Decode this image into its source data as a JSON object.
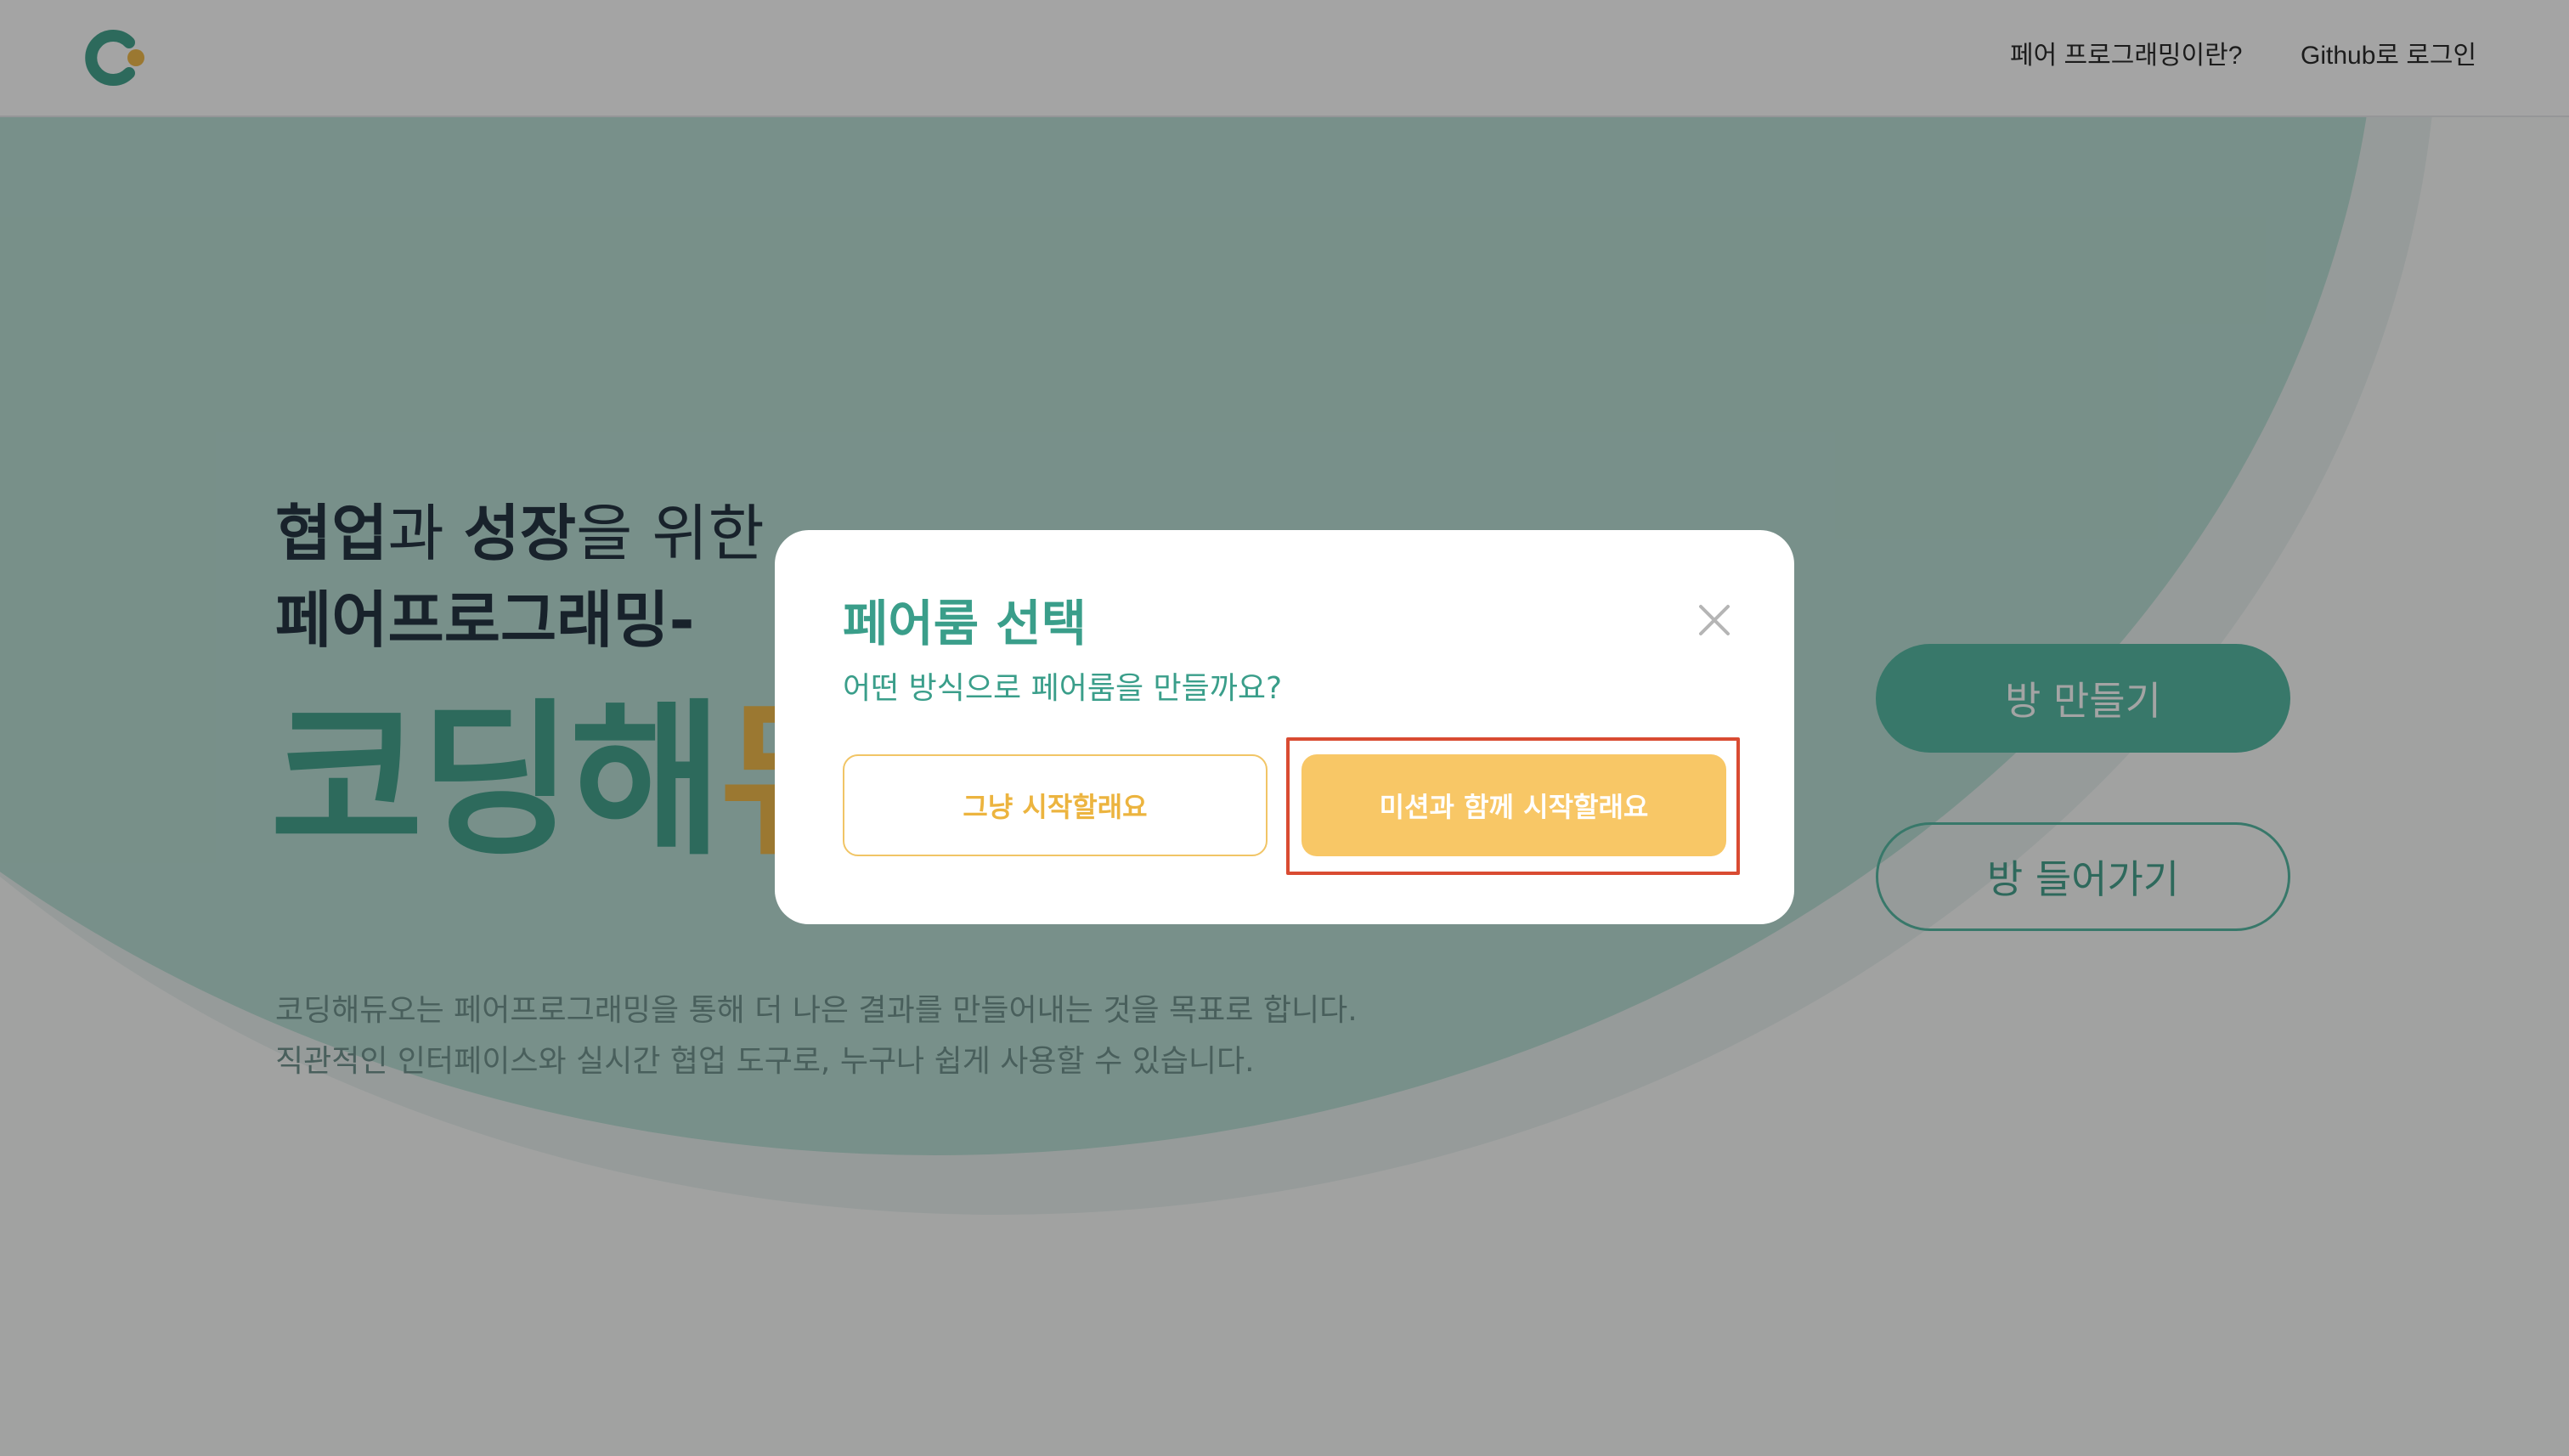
{
  "header": {
    "logo_icon": "coding-duo-logo-icon",
    "nav": [
      {
        "label": "페어 프로그래밍이란?"
      },
      {
        "label": "Github로 로그인"
      }
    ]
  },
  "hero": {
    "line1_bold_1": "협업",
    "line1_text_1": "과 ",
    "line1_bold_2": "성장",
    "line1_text_2": "을 위한",
    "line2": "페어프로그래밍-",
    "brand_main": "코딩해",
    "brand_accent": "듀",
    "description_1": "코딩해듀오는 페어프로그래밍을 통해 더 나은 결과를 만들어내는 것을 목표로 합니다.",
    "description_2": "직관적인 인터페이스와 실시간 협업 도구로, 누구나 쉽게 사용할 수 있습니다."
  },
  "actions": {
    "create_room": "방 만들기",
    "join_room": "방 들어가기"
  },
  "modal": {
    "title": "페어룸 선택",
    "subtitle": "어떤 방식으로 페어룸을 만들까요?",
    "close_icon": "close-icon",
    "option_plain": "그냥 시작할래요",
    "option_mission": "미션과 함께 시작할래요"
  },
  "colors": {
    "brand_green": "#3da08a",
    "brand_yellow": "#f1b843",
    "highlight_red": "#d94b32"
  }
}
